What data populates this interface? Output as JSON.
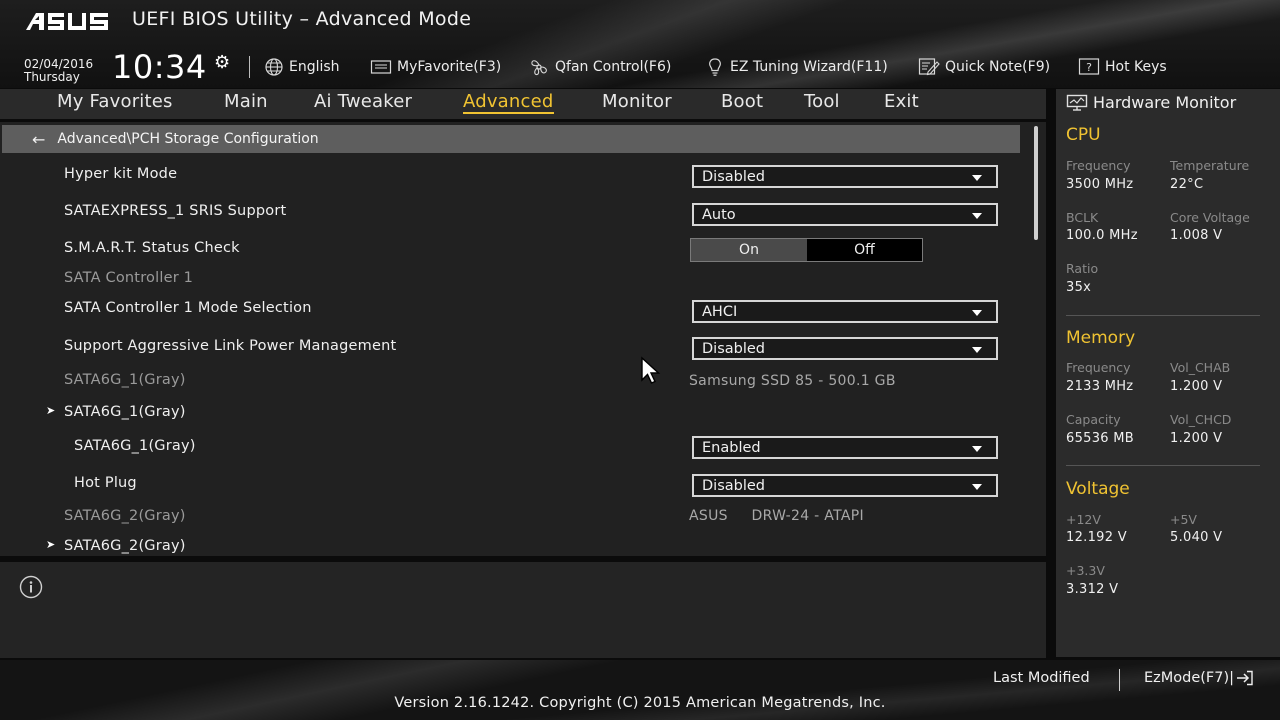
{
  "header": {
    "brand": "ASUS",
    "title": "UEFI BIOS Utility – Advanced Mode",
    "date": "02/04/2016",
    "weekday": "Thursday",
    "time": "10:34",
    "tools": [
      {
        "label": "English",
        "icon": "globe-icon"
      },
      {
        "label": "MyFavorite(F3)",
        "icon": "favorite-icon"
      },
      {
        "label": "Qfan Control(F6)",
        "icon": "fan-icon"
      },
      {
        "label": "EZ Tuning Wizard(F11)",
        "icon": "lightbulb-icon"
      },
      {
        "label": "Quick Note(F9)",
        "icon": "note-icon"
      },
      {
        "label": "Hot Keys",
        "icon": "help-icon",
        "glyph": "?"
      }
    ]
  },
  "tabs": [
    {
      "label": "My Favorites",
      "active": false
    },
    {
      "label": "Main",
      "active": false
    },
    {
      "label": "Ai Tweaker",
      "active": false
    },
    {
      "label": "Advanced",
      "active": true
    },
    {
      "label": "Monitor",
      "active": false
    },
    {
      "label": "Boot",
      "active": false
    },
    {
      "label": "Tool",
      "active": false
    },
    {
      "label": "Exit",
      "active": false
    }
  ],
  "breadcrumb": "Advanced\\PCH Storage Configuration",
  "settings": {
    "hyper_kit": {
      "label": "Hyper kit Mode",
      "value": "Disabled"
    },
    "sataexpress": {
      "label": "SATAEXPRESS_1 SRIS Support",
      "value": "Auto"
    },
    "smart": {
      "label": "S.M.A.R.T. Status Check",
      "on": "On",
      "off": "Off",
      "selected": "On"
    },
    "sata_ctrl_header": "SATA Controller 1",
    "sata_mode": {
      "label": "SATA Controller 1 Mode Selection",
      "value": "AHCI"
    },
    "alpm": {
      "label": "Support Aggressive Link Power Management",
      "value": "Disabled"
    },
    "port1_info": {
      "label": "SATA6G_1(Gray)",
      "value": "Samsung SSD 85 - 500.1 GB"
    },
    "port1_group": "SATA6G_1(Gray)",
    "port1_enable": {
      "label": "SATA6G_1(Gray)",
      "value": "Enabled"
    },
    "port1_hotplug": {
      "label": "Hot Plug",
      "value": "Disabled"
    },
    "port2_info": {
      "label": "SATA6G_2(Gray)",
      "value": "ASUS     DRW-24 - ATAPI"
    },
    "port2_group": "SATA6G_2(Gray)"
  },
  "hardware_monitor": {
    "title": "Hardware Monitor",
    "cpu": {
      "title": "CPU",
      "frequency_label": "Frequency",
      "frequency": "3500 MHz",
      "temperature_label": "Temperature",
      "temperature": "22°C",
      "bclk_label": "BCLK",
      "bclk": "100.0 MHz",
      "core_voltage_label": "Core Voltage",
      "core_voltage": "1.008 V",
      "ratio_label": "Ratio",
      "ratio": "35x"
    },
    "memory": {
      "title": "Memory",
      "frequency_label": "Frequency",
      "frequency": "2133 MHz",
      "vol_chab_label": "Vol_CHAB",
      "vol_chab": "1.200 V",
      "capacity_label": "Capacity",
      "capacity": "65536 MB",
      "vol_chcd_label": "Vol_CHCD",
      "vol_chcd": "1.200 V"
    },
    "voltage": {
      "title": "Voltage",
      "v12_label": "+12V",
      "v12": "12.192 V",
      "v5_label": "+5V",
      "v5": "5.040 V",
      "v33_label": "+3.3V",
      "v33": "3.312 V"
    }
  },
  "footer": {
    "last_modified": "Last Modified",
    "ezmode": "EzMode(F7)|",
    "version": "Version 2.16.1242. Copyright (C) 2015 American Megatrends, Inc."
  },
  "colors": {
    "accent": "#f0c332",
    "panel": "#212121",
    "breadcrumb": "#5e5e5e"
  }
}
